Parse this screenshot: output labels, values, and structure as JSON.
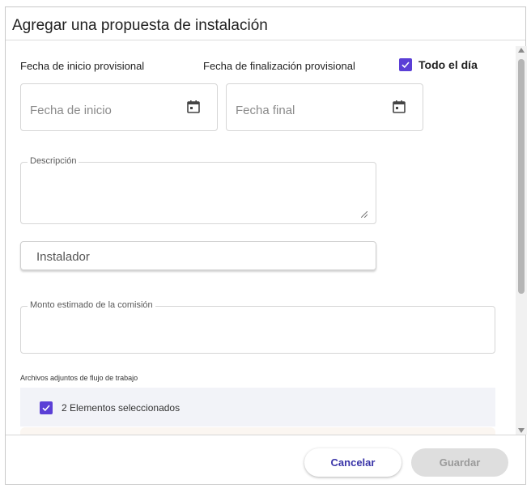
{
  "dialog": {
    "title": "Agregar una propuesta de instalación"
  },
  "form": {
    "start_date_label": "Fecha de inicio provisional",
    "end_date_label": "Fecha de finalización provisional",
    "all_day": {
      "label": "Todo el día",
      "checked": true
    },
    "start_date": {
      "placeholder": "Fecha de inicio",
      "icon": "calendar-icon"
    },
    "end_date": {
      "placeholder": "Fecha final",
      "icon": "calendar-icon"
    },
    "description": {
      "legend": "Descripción",
      "value": ""
    },
    "installer": {
      "placeholder": "Instalador"
    },
    "commission": {
      "legend": "Monto estimado de la comisión",
      "value": ""
    },
    "attachments": {
      "label": "Archivos adjuntos de flujo de trabajo",
      "selected_text": "2 Elementos seleccionados",
      "checked": true
    }
  },
  "footer": {
    "cancel_label": "Cancelar",
    "save_label": "Guardar"
  },
  "colors": {
    "accent": "#5b3fd6",
    "cancel_text": "#3a35a8",
    "save_disabled_bg": "#dedede"
  }
}
